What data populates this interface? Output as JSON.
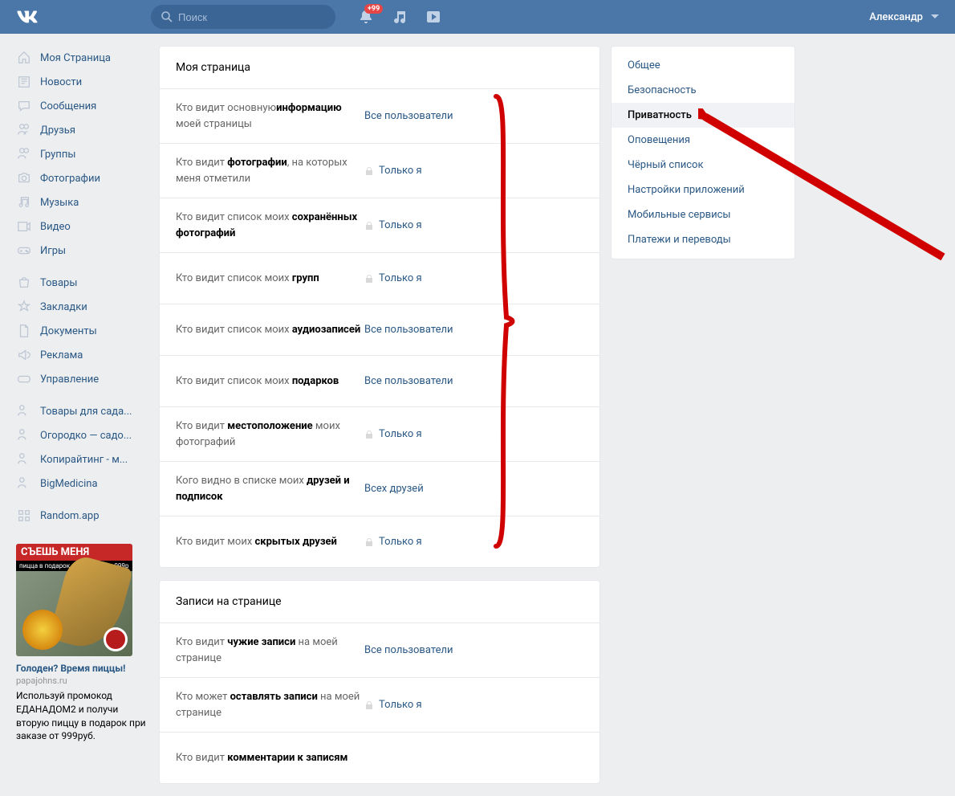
{
  "header": {
    "search_placeholder": "Поиск",
    "badge": "+99",
    "username": "Александр"
  },
  "left_nav": {
    "items1": [
      "Моя Страница",
      "Новости",
      "Сообщения",
      "Друзья",
      "Группы",
      "Фотографии",
      "Музыка",
      "Видео",
      "Игры"
    ],
    "items2": [
      "Товары",
      "Закладки",
      "Документы",
      "Реклама",
      "Управление"
    ],
    "items3": [
      "Товары для сада...",
      "Огородко — садо...",
      "Копирайтинг - м...",
      "BigMedicina"
    ],
    "items4": [
      "Random.app"
    ]
  },
  "ad": {
    "banner": "СЪЕШЬ МЕНЯ",
    "sub": "пицца в подарок при заказе от 999р",
    "title": "Голоден? Время пиццы!",
    "domain": "papajohns.ru",
    "text": "Используй промокод ЕДАНАДОМ2 и получи вторую пиццу в подарок при заказе от 999руб."
  },
  "sections": [
    {
      "title": "Моя страница",
      "rows": [
        {
          "p1": "Кто видит основную",
          "p2": "информацию",
          "p3": " моей страницы",
          "val": "Все пользователи",
          "lock": false
        },
        {
          "p1": "Кто видит ",
          "p2": "фотографии",
          "p3": ", на которых меня отметили",
          "val": "Только я",
          "lock": true
        },
        {
          "p1": "Кто видит список моих",
          "p2": " сохранённых фотографий",
          "p3": "",
          "val": "Только я",
          "lock": true
        },
        {
          "p1": "Кто видит",
          "p2": "",
          "p3": " список моих ",
          "p4": "групп",
          "val": "Только я",
          "lock": true
        },
        {
          "p1": "Кто видит",
          "p2": "",
          "p3": " список моих ",
          "p4": "аудиозаписей",
          "val": "Все пользователи",
          "lock": false
        },
        {
          "p1": "Кто видит",
          "p2": "",
          "p3": " список моих ",
          "p4": "подарков",
          "val": "Все пользователи",
          "lock": false
        },
        {
          "p1": "Кто видит ",
          "p2": "местоположение",
          "p3": " моих фотографий",
          "val": "Только я",
          "lock": true
        },
        {
          "p1": "Кого видно в списке",
          "p2": "",
          "p3": " моих ",
          "p4": "друзей и подписок",
          "val": "Всех друзей",
          "lock": false
        },
        {
          "p1": "Кто видит",
          "p2": "",
          "p3": " моих ",
          "p4": "скрытых друзей",
          "val": "Только я",
          "lock": true
        }
      ]
    },
    {
      "title": "Записи на странице",
      "rows": [
        {
          "p1": "Кто видит ",
          "p2": "чужие записи",
          "p3": " на моей странице",
          "val": "Все пользователи",
          "lock": false
        },
        {
          "p1": "Кто может ",
          "p2": "оставлять записи",
          "p3": " на моей странице",
          "val": "Только я",
          "lock": true
        },
        {
          "p1": "Кто видит",
          "p2": "",
          "p3": " ",
          "p4": "комментарии к записям",
          "val": "",
          "lock": false
        }
      ]
    }
  ],
  "right_nav": {
    "items": [
      "Общее",
      "Безопасность",
      "Приватность",
      "Оповещения",
      "Чёрный список",
      "Настройки приложений",
      "Мобильные сервисы",
      "Платежи и переводы"
    ],
    "active": 2
  }
}
